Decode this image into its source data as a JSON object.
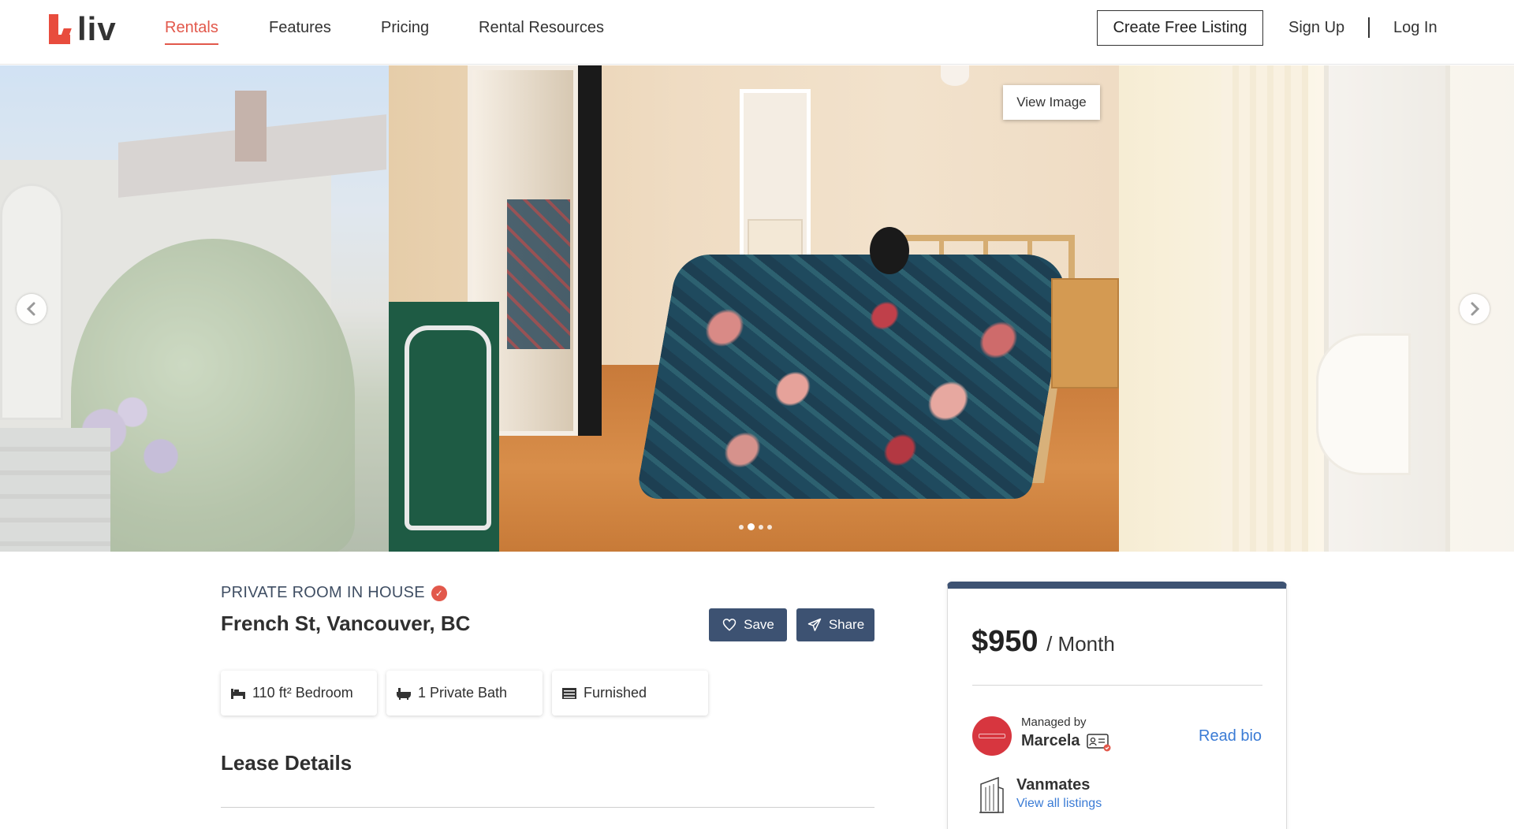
{
  "nav": {
    "logo_text": "liv",
    "links": [
      {
        "label": "Rentals",
        "active": true
      },
      {
        "label": "Features",
        "active": false
      },
      {
        "label": "Pricing",
        "active": false
      },
      {
        "label": "Rental Resources",
        "active": false
      }
    ],
    "create_listing": "Create Free Listing",
    "sign_up": "Sign Up",
    "log_in": "Log In"
  },
  "gallery": {
    "view_image": "View Image",
    "prev_icon": "chevron-left-icon",
    "next_icon": "chevron-right-icon",
    "slide_count": 4,
    "active_slide": 2
  },
  "listing": {
    "type": "PRIVATE ROOM IN HOUSE",
    "address": "French St, Vancouver, BC",
    "save_label": "Save",
    "share_label": "Share",
    "features": [
      {
        "label": "110 ft² Bedroom",
        "icon": "bed-icon"
      },
      {
        "label": "1 Private Bath",
        "icon": "bathtub-icon"
      },
      {
        "label": "Furnished",
        "icon": "furniture-icon"
      }
    ],
    "lease_title": "Lease Details"
  },
  "price_card": {
    "price": "$950",
    "unit": "/ Month",
    "managed_by_label": "Managed by",
    "manager_name": "Marcela",
    "read_bio": "Read bio",
    "company": "Vanmates",
    "view_all": "View all listings"
  },
  "colors": {
    "accent": "#e2584b",
    "navy": "#3d5272",
    "link": "#3a7bd5"
  }
}
